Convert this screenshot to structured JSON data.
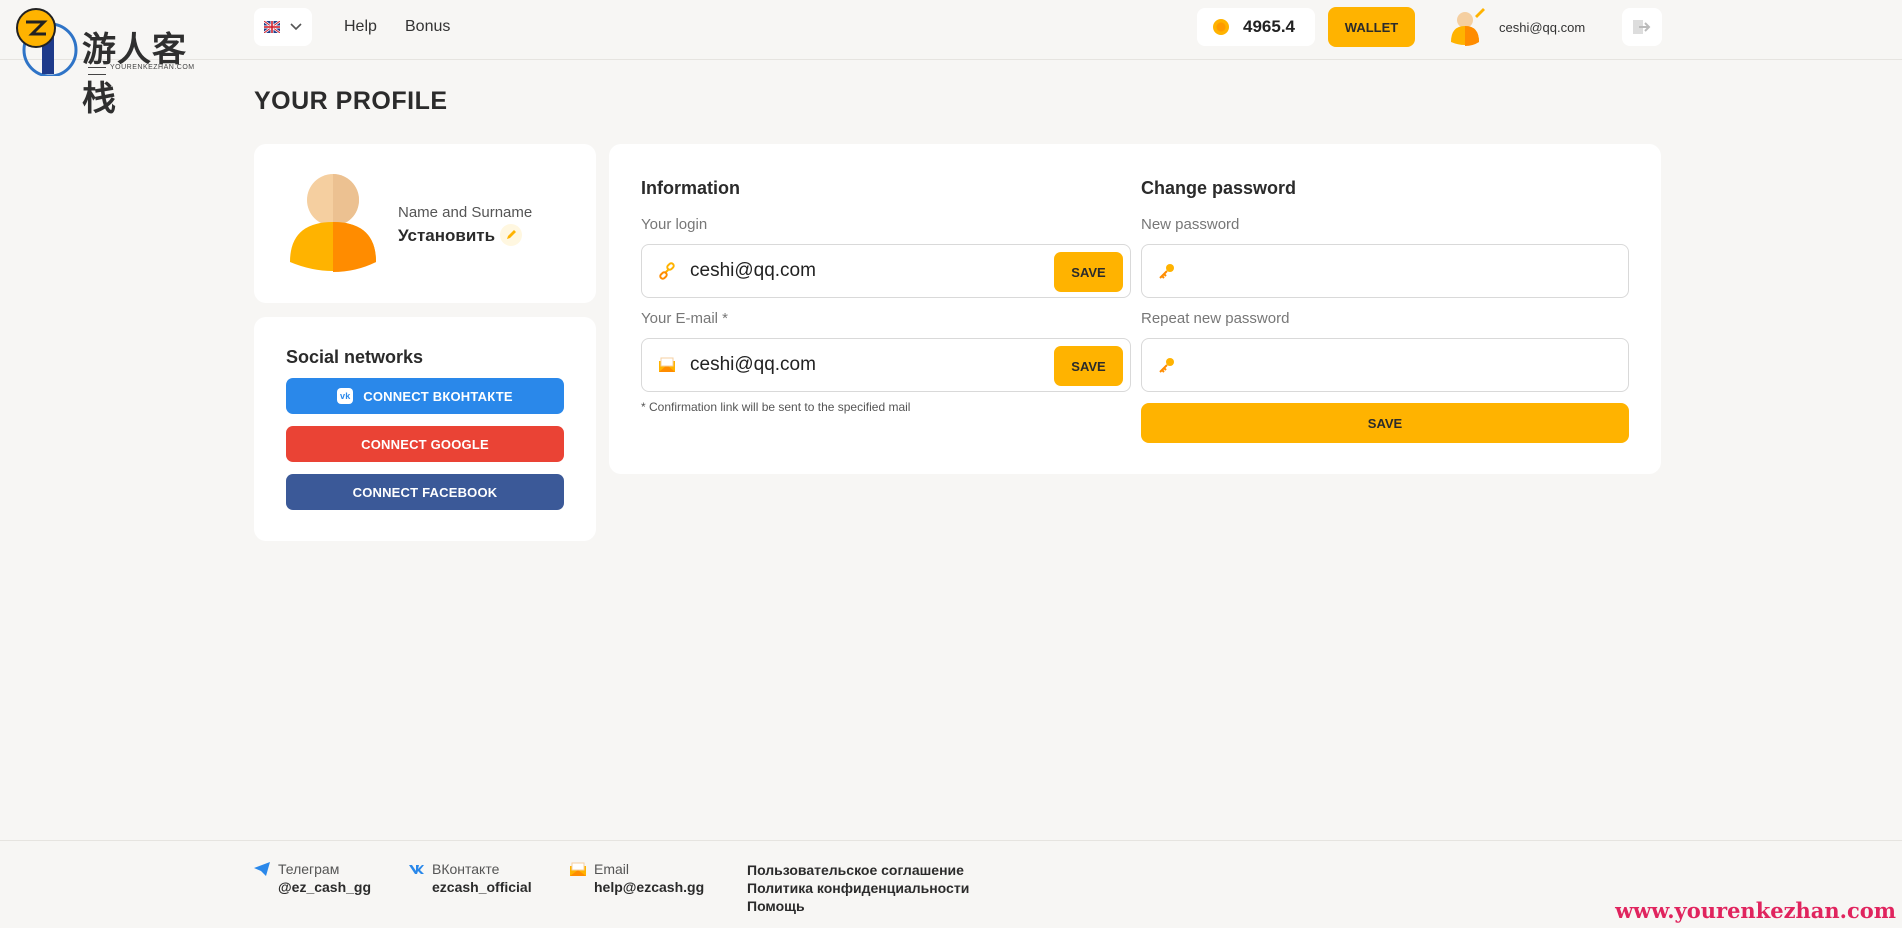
{
  "logo": {
    "text": "游人客栈",
    "sub": "YOURENKEZHAN.COM"
  },
  "header": {
    "nav": [
      "Help",
      "Bonus"
    ],
    "balance": "4965.4",
    "wallet_label": "WALLET",
    "user_email": "ceshi@qq.com"
  },
  "page_title": "YOUR PROFILE",
  "profile": {
    "name_label": "Name and Surname",
    "name_value": "Установить"
  },
  "social": {
    "title": "Social networks",
    "buttons": [
      "CONNECT ВКОНТАКТЕ",
      "CONNECT GOOGLE",
      "CONNECT FACEBOOK"
    ]
  },
  "information": {
    "title": "Information",
    "login_label": "Your login",
    "login_value": "ceshi@qq.com",
    "email_label": "Your E-mail *",
    "email_value": "ceshi@qq.com",
    "save_label": "SAVE",
    "note": "* Confirmation link will be sent to the specified mail"
  },
  "password": {
    "title": "Change password",
    "new_label": "New password",
    "repeat_label": "Repeat new password",
    "save_label": "SAVE"
  },
  "footer": {
    "telegram_label": "Телеграм",
    "telegram_value": "@ez_cash_gg",
    "vk_label": "ВКонтакте",
    "vk_value": "ezcash_official",
    "email_label": "Email",
    "email_value": "help@ezcash.gg",
    "links": [
      "Пользовательское соглашение",
      "Политика конфиденциальности",
      "Помощь"
    ]
  },
  "watermark": "www.yourenkezhan.com",
  "colors": {
    "accent": "#ffb300",
    "vk": "#2a88ea",
    "google": "#ea4335",
    "facebook": "#3b5998"
  }
}
